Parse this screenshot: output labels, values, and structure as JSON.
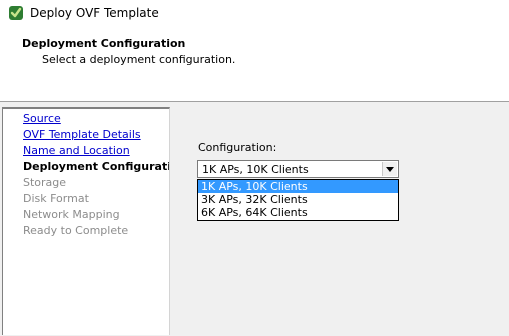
{
  "window": {
    "title": "Deploy OVF Template",
    "icon": "vsphere-logo-icon"
  },
  "header": {
    "title": "Deployment Configuration",
    "subtitle": "Select a deployment configuration."
  },
  "steps": [
    {
      "label": "Source",
      "state": "link"
    },
    {
      "label": "OVF Template Details",
      "state": "link"
    },
    {
      "label": "Name and Location",
      "state": "link"
    },
    {
      "label": "Deployment Configuration",
      "state": "current"
    },
    {
      "label": "Storage",
      "state": "pending"
    },
    {
      "label": "Disk Format",
      "state": "pending"
    },
    {
      "label": "Network Mapping",
      "state": "pending"
    },
    {
      "label": "Ready to Complete",
      "state": "pending"
    }
  ],
  "configuration": {
    "label": "Configuration:",
    "selected": "1K APs, 10K Clients",
    "options": [
      {
        "label": "1K APs, 10K Clients",
        "highlighted": true
      },
      {
        "label": "3K APs, 32K Clients",
        "highlighted": false
      },
      {
        "label": "6K APs, 64K Clients",
        "highlighted": false
      }
    ]
  },
  "colors": {
    "link": "#0000cc",
    "highlight": "#3399ff",
    "band": "#f0f0f0"
  }
}
